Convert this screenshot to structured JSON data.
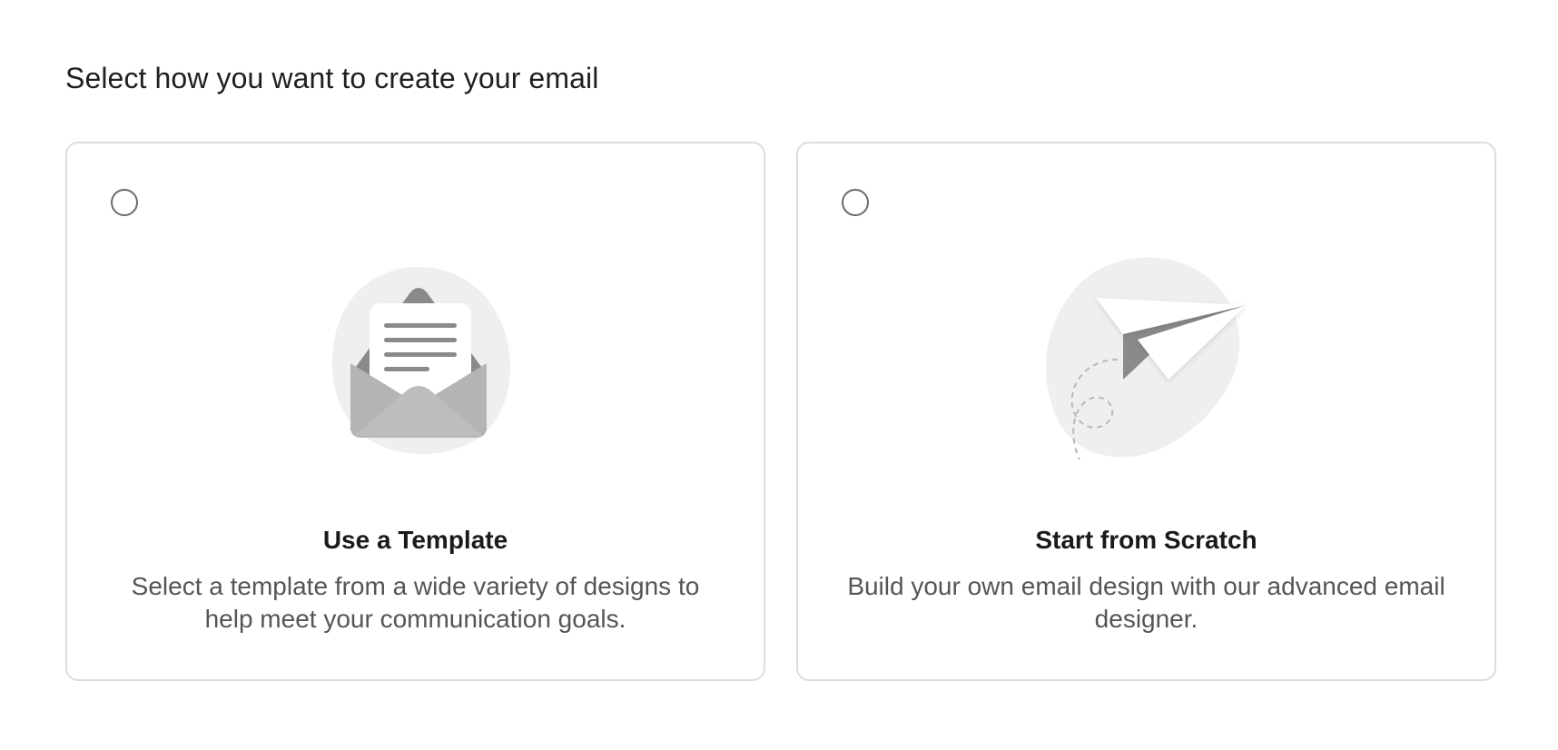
{
  "page": {
    "heading": "Select how you want to create your email"
  },
  "options": [
    {
      "title": "Use a Template",
      "description": "Select a template from a wide variety of designs to help meet your communication goals.",
      "icon": "envelope-letter-icon",
      "selected": false
    },
    {
      "title": "Start from Scratch",
      "description": "Build your own email design with our advanced email designer.",
      "icon": "paper-plane-icon",
      "selected": false
    }
  ],
  "colors": {
    "card_border": "#dddddd",
    "radio_border": "#6b6b6b",
    "illustration_blob": "#efefef",
    "illustration_dark": "#8a8a8c",
    "illustration_mid": "#b4b4b6",
    "heading_text": "#1f1f1f",
    "description_text": "#555555"
  }
}
